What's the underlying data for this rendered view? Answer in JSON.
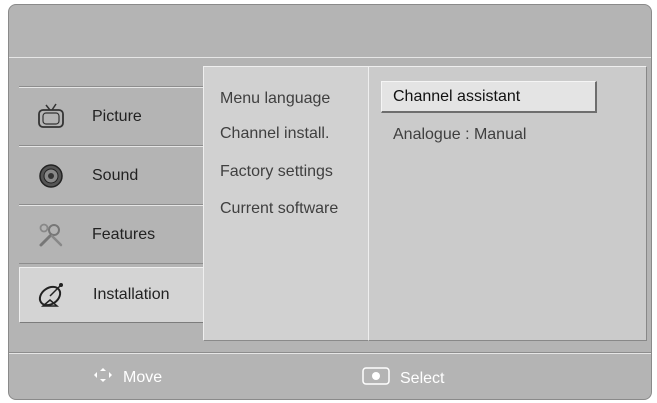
{
  "left_menu": {
    "items": [
      {
        "label": "Picture",
        "icon": "tv-icon"
      },
      {
        "label": "Sound",
        "icon": "speaker-icon"
      },
      {
        "label": "Features",
        "icon": "tools-icon"
      },
      {
        "label": "Installation",
        "icon": "satellite-dish-icon",
        "selected": true
      }
    ]
  },
  "middle_menu": {
    "items": [
      "Menu language",
      "Channel install.",
      "Factory settings",
      "Current software"
    ]
  },
  "right_menu": {
    "items": [
      "Channel assistant",
      "Analogue : Manual"
    ],
    "selected_index": 0
  },
  "footer": {
    "move_label": "Move",
    "select_label": "Select"
  },
  "colors": {
    "background": "#b4b4b4",
    "panel": "#d1d1d1",
    "highlight": "#e4e4e4",
    "footer_text": "#ffffff"
  }
}
